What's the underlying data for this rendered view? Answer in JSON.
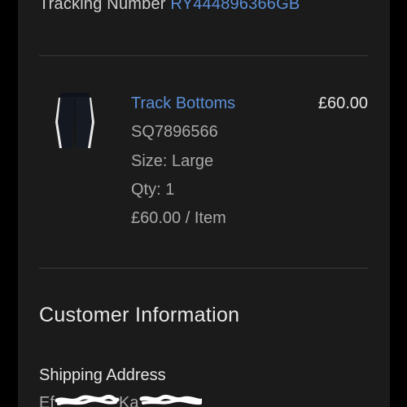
{
  "tracking": {
    "label": "Tracking Number",
    "number": "RY444896366GB"
  },
  "item": {
    "name": "Track Bottoms",
    "price": "£60.00",
    "sku": "SQ7896566",
    "size": "Size: Large",
    "qty": "Qty: 1",
    "unit_price": "£60.00 / Item",
    "thumbnail_icon": "track-pants-image"
  },
  "customer": {
    "section_title": "Customer Information",
    "shipping_title": "Shipping Address",
    "address_visible_start": "Ef",
    "address_visible_mid": "Ka"
  },
  "colors": {
    "background": "#000000",
    "panel": "#1b1b1b",
    "link": "#5b8fd6",
    "text_primary": "#e6e6e6",
    "text_secondary": "#a9a9a9",
    "divider": "#3a3a3a"
  }
}
